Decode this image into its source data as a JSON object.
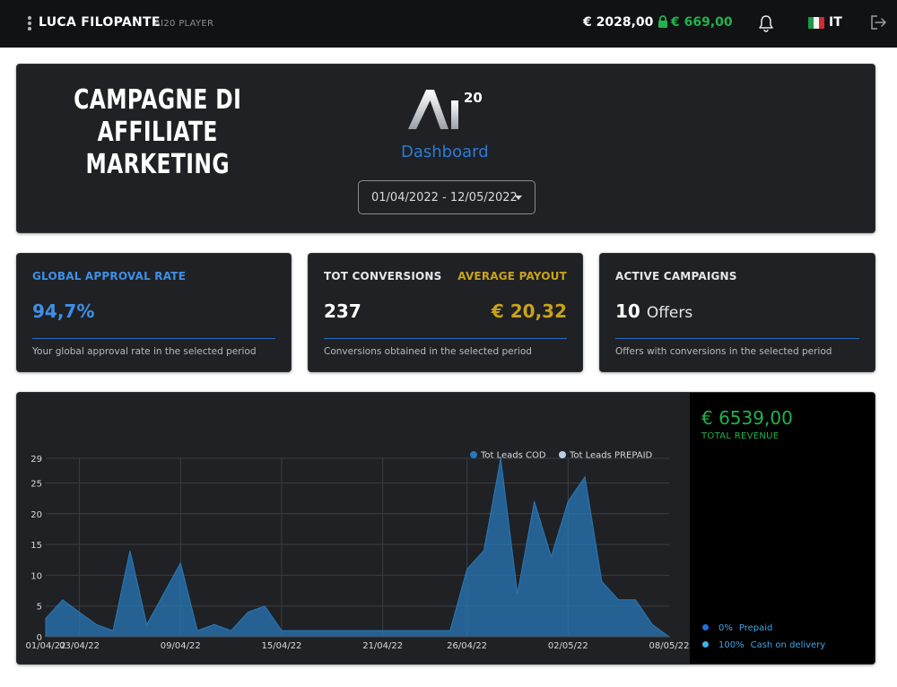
{
  "topbar": {
    "user_name": "LUCA FILOPANTE",
    "user_role": "AI20 PLAYER",
    "balance": "€ 2028,00",
    "locked_balance": "€ 669,00",
    "language": "IT"
  },
  "header": {
    "title_line1": "CAMPAGNE DI",
    "title_line2": "AFFILIATE MARKETING",
    "logo_mark": "Ai",
    "logo_sup": "20",
    "logo_label": "Dashboard",
    "date_range": "01/04/2022 - 12/05/2022"
  },
  "stats": {
    "approval": {
      "label": "GLOBAL APPROVAL RATE",
      "value": "94,7%",
      "description": "Your global approval rate in the selected period"
    },
    "conversions": {
      "label": "TOT CONVERSIONS",
      "value": "237",
      "payout_label": "AVERAGE PAYOUT",
      "payout_value": "€ 20,32",
      "description": "Conversions obtained in the selected period"
    },
    "campaigns": {
      "label": "ACTIVE CAMPAIGNS",
      "value": "10",
      "unit": "Offers",
      "description": "Offers with conversions in the selected period"
    }
  },
  "revenue": {
    "amount": "€ 6539,00",
    "label": "TOTAL REVENUE",
    "payments": [
      {
        "percent": "0%",
        "label": "Prepaid",
        "color": "#1f6fe0"
      },
      {
        "percent": "100%",
        "label": "Cash on delivery",
        "color": "#3fb4ea"
      }
    ]
  },
  "colors": {
    "cod": "#2878b8",
    "prepaid": "#b9cfe6",
    "positive": "#22b24c",
    "accent_blue": "#3f8fe6",
    "accent_gold": "#c8a21a"
  },
  "chart_data": {
    "type": "area",
    "x": [
      "01/04/22",
      "02/04/22",
      "03/04/22",
      "04/04/22",
      "05/04/22",
      "06/04/22",
      "07/04/22",
      "08/04/22",
      "09/04/22",
      "10/04/22",
      "11/04/22",
      "12/04/22",
      "13/04/22",
      "14/04/22",
      "15/04/22",
      "16/04/22",
      "17/04/22",
      "18/04/22",
      "19/04/22",
      "20/04/22",
      "21/04/22",
      "22/04/22",
      "23/04/22",
      "24/04/22",
      "25/04/22",
      "26/04/22",
      "27/04/22",
      "28/04/22",
      "29/04/22",
      "30/04/22",
      "01/05/22",
      "02/05/22",
      "03/05/22",
      "04/05/22",
      "05/05/22",
      "06/05/22",
      "07/05/22",
      "08/05/22"
    ],
    "tick_labels": [
      "01/04/22",
      "03/04/22",
      "09/04/22",
      "15/04/22",
      "21/04/22",
      "26/04/22",
      "02/05/22",
      "08/05/22"
    ],
    "tick_indices": [
      0,
      2,
      8,
      14,
      20,
      25,
      31,
      37
    ],
    "y_ticks": [
      "0",
      "5",
      "10",
      "15",
      "20",
      "25",
      "29"
    ],
    "ylim": [
      0,
      29
    ],
    "grid": true,
    "legend_position": "top-right",
    "series": [
      {
        "name": "Tot Leads COD",
        "values": [
          3,
          6,
          4,
          2,
          1,
          14,
          2,
          7,
          12,
          1,
          2,
          1,
          4,
          5,
          1,
          1,
          1,
          1,
          1,
          1,
          1,
          1,
          1,
          1,
          1,
          11,
          14,
          29,
          7,
          22,
          13,
          22,
          26,
          9,
          6,
          6,
          2,
          0
        ]
      },
      {
        "name": "Tot Leads PREPAID",
        "values": [
          0,
          0,
          0,
          0,
          0,
          0,
          0,
          0,
          0,
          0,
          0,
          0,
          0,
          0,
          0,
          0,
          0,
          0,
          0,
          0,
          0,
          0,
          0,
          0,
          0,
          0,
          0,
          0,
          0,
          0,
          0,
          0,
          0,
          0,
          0,
          0,
          0,
          0
        ]
      }
    ]
  }
}
